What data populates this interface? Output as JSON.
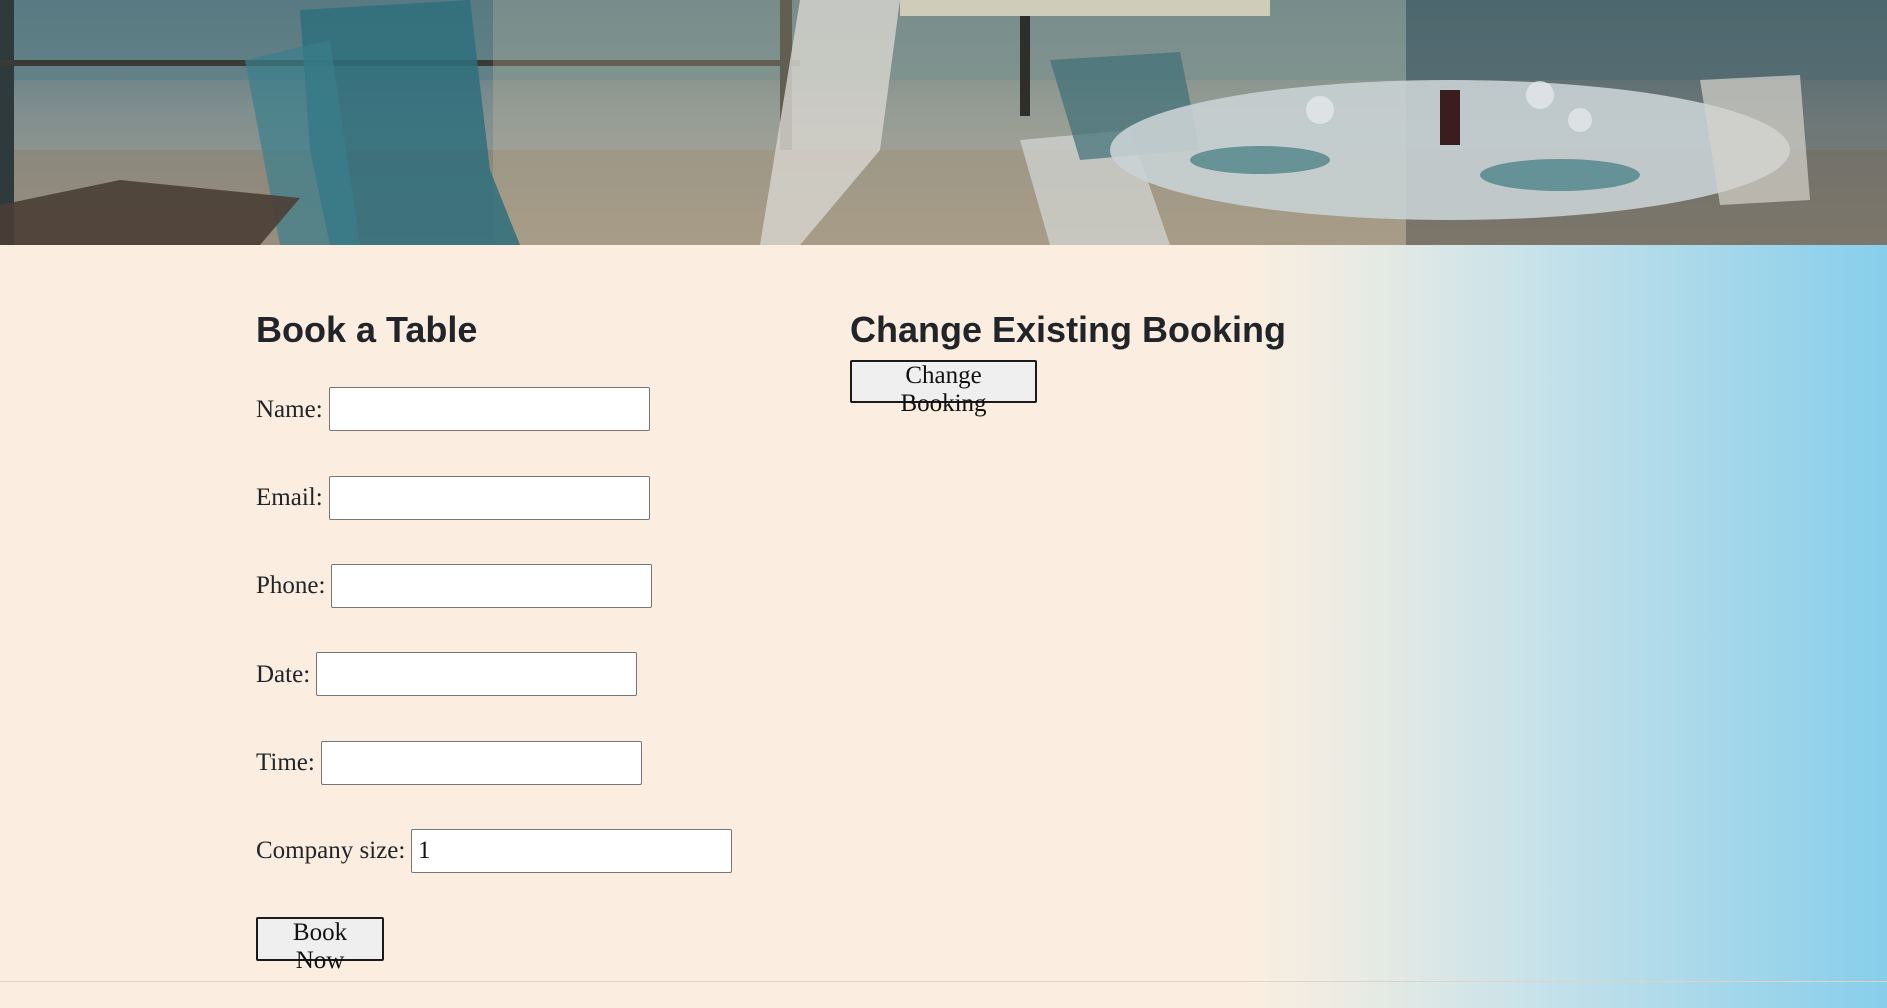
{
  "hero": {
    "image": "restaurant-terrace-photo"
  },
  "booking_form": {
    "title": "Book a Table",
    "fields": [
      {
        "label": "Name:",
        "value": ""
      },
      {
        "label": "Email:",
        "value": ""
      },
      {
        "label": "Phone:",
        "value": ""
      },
      {
        "label": "Date:",
        "value": ""
      },
      {
        "label": "Time:",
        "value": ""
      },
      {
        "label": "Company size:",
        "value": "1"
      }
    ],
    "submit_label": "Book Now"
  },
  "change_booking": {
    "title": "Change Existing Booking",
    "button_label": "Change Booking"
  },
  "colors": {
    "page_background": "#fbeee0",
    "gradient_end": "#87ceeb",
    "heading": "#212529"
  }
}
